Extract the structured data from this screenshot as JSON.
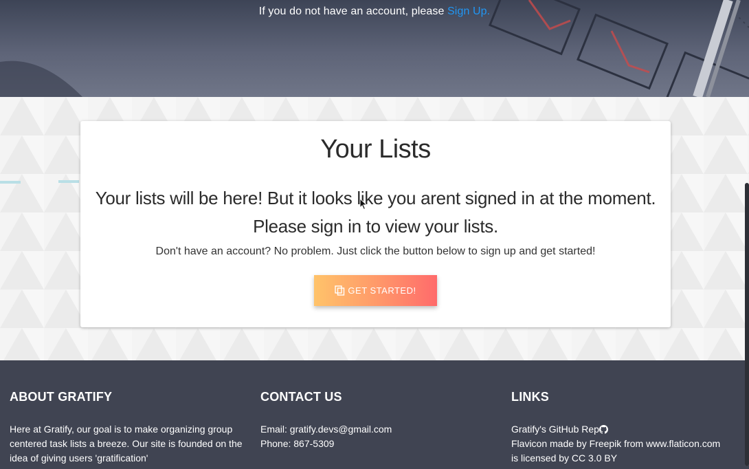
{
  "hero": {
    "prefix": "If you do not have an account, please ",
    "link": "Sign Up."
  },
  "card": {
    "title": "Your Lists",
    "line1": "Your lists will be here! But it looks like you arent signed in at the moment.",
    "line2": "Please sign in to view your lists.",
    "note": "Don't have an account? No problem. Just click the button below to sign up and get started!",
    "button": "GET STARTED!",
    "button_icon": "copy-icon"
  },
  "footer": {
    "about": {
      "title": "ABOUT GRATIFY",
      "text": "Here at Gratify, our goal is to make organizing group centered task lists a breeze. Our site is founded on the idea of giving users 'gratification'"
    },
    "contact": {
      "title": "CONTACT US",
      "email": "Email: gratify.devs@gmail.com",
      "phone": "Phone: 867-5309"
    },
    "links": {
      "title": "LINKS",
      "github": "Gratify's GitHub Rep",
      "github_icon": "github-icon",
      "flaticon": "Flavicon made by Freepik from www.flaticon.com",
      "license": "is licensed by CC 3.0 BY"
    }
  },
  "colors": {
    "link_blue": "#2196f3",
    "footer_bg": "#404452",
    "button_start": "#ffc36a",
    "button_end": "#ff6b6b"
  }
}
